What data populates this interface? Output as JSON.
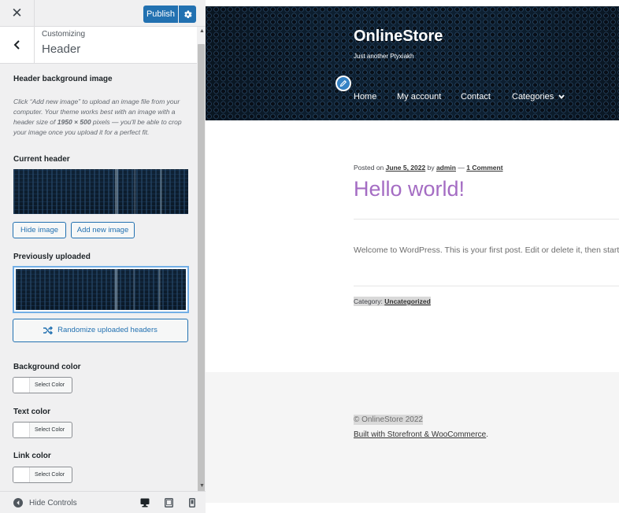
{
  "customizer": {
    "close_icon": "close-icon",
    "publish_label": "Publish",
    "gear_icon": "gear-icon",
    "back_icon": "chevron-left-icon",
    "breadcrumb": "Customizing",
    "section_title": "Header",
    "header_image": {
      "heading": "Header background image",
      "description_pre": "Click “Add new image” to upload an image file from your computer. Your theme works best with an image with a header size of ",
      "description_size": "1950 × 500",
      "description_post": " pixels — you'll be able to crop your image once you upload it for a perfect fit.",
      "current_label": "Current header",
      "hide_button": "Hide image",
      "add_button": "Add new image",
      "previous_label": "Previously uploaded",
      "randomize_button": "Randomize uploaded headers"
    },
    "colors": {
      "background_label": "Background color",
      "text_label": "Text color",
      "link_label": "Link color",
      "select_label": "Select Color"
    },
    "footer": {
      "hide_controls": "Hide Controls"
    },
    "accent_color": "#2271b1"
  },
  "site": {
    "title": "OnlineStore",
    "tagline": "Just another Ptyxiakh",
    "nav": [
      {
        "label": "Home"
      },
      {
        "label": "My account"
      },
      {
        "label": "Contact"
      },
      {
        "label": "Categories"
      }
    ],
    "post": {
      "posted_on": "Posted on",
      "date": "June 5, 2022",
      "by": "by",
      "author": "admin",
      "dash": "—",
      "comments": "1 Comment",
      "title": "Hello world!",
      "body": "Welcome to WordPress. This is your first post. Edit or delete it, then start writing!",
      "category_prefix": "Category:",
      "category": "Uncategorized"
    },
    "footer": {
      "copyright": "© OnlineStore 2022",
      "built_with": "Built with Storefront & WooCommerce",
      "built_with_suffix": "."
    },
    "title_color": "#a46cc3"
  }
}
